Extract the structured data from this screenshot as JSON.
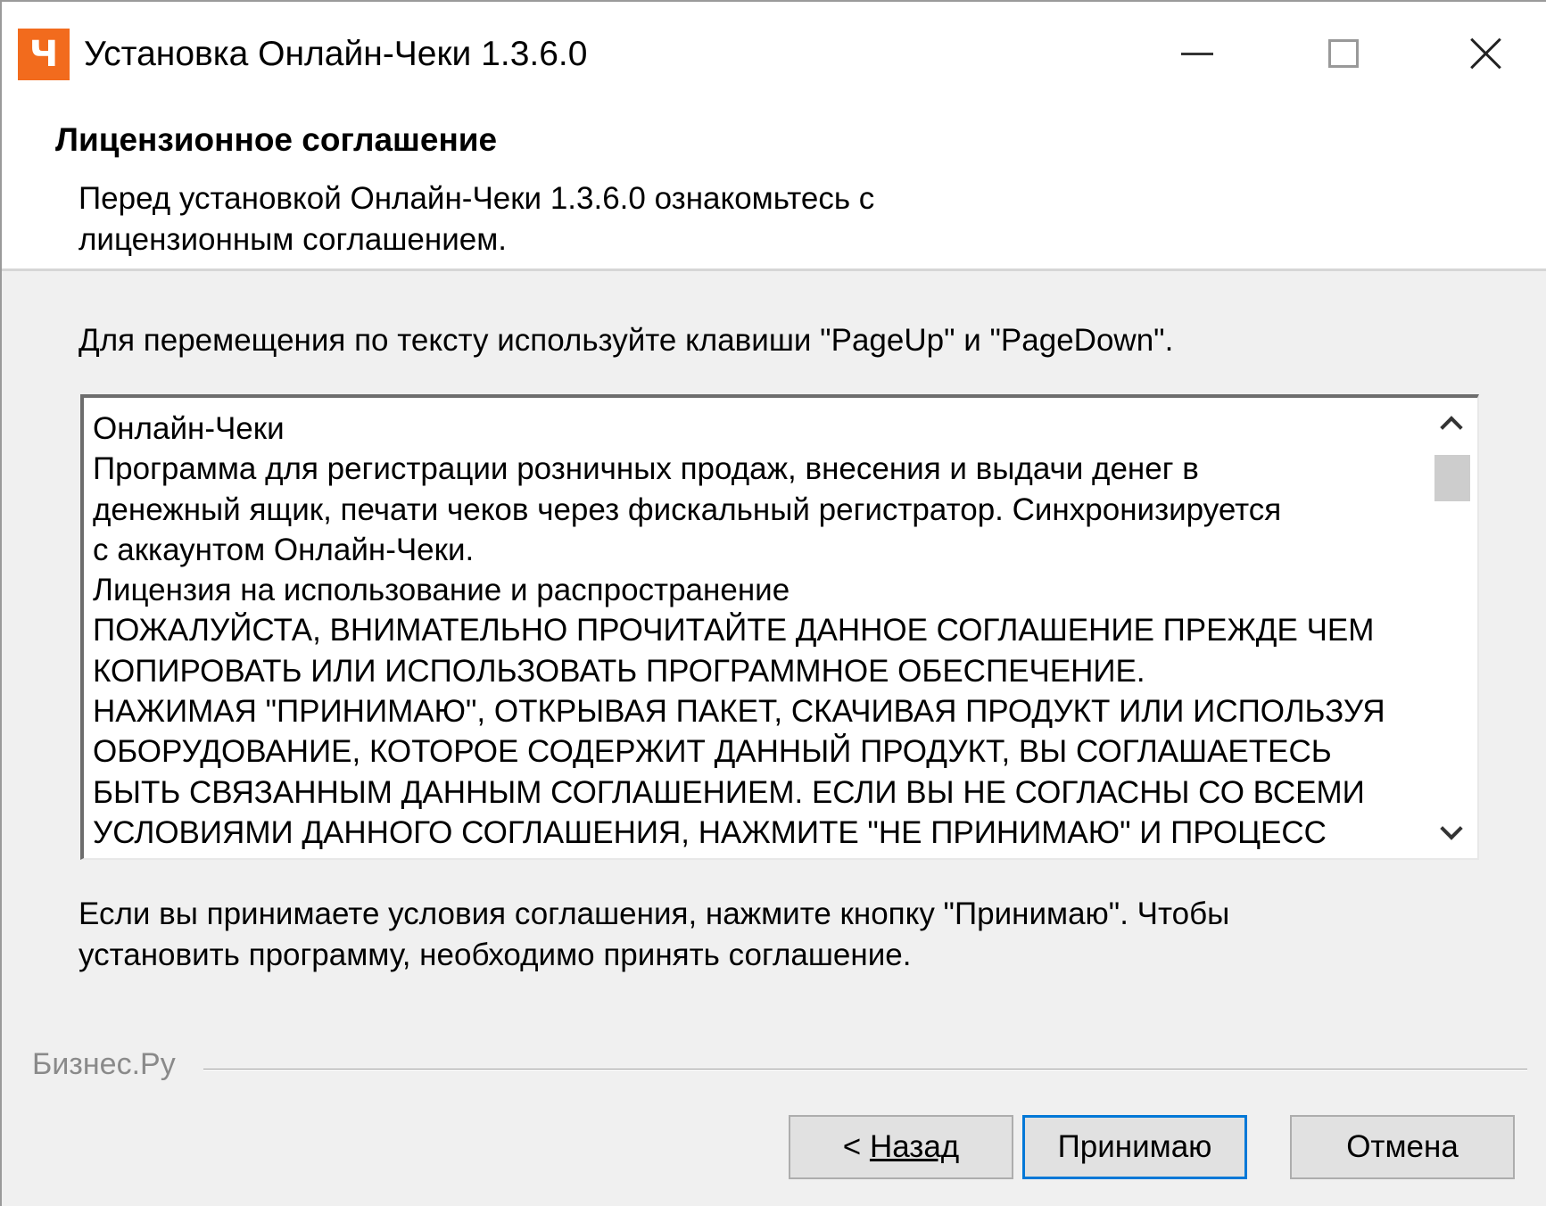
{
  "window": {
    "app_icon_glyph": "Ч",
    "title": "Установка Онлайн-Чеки 1.3.6.0",
    "accent_color": "#f26b1d"
  },
  "header": {
    "title": "Лицензионное соглашение",
    "subtitle_line1": "Перед установкой Онлайн-Чеки 1.3.6.0 ознакомьтесь с",
    "subtitle_line2": "лицензионным соглашением."
  },
  "nav_hint": "Для перемещения по тексту используйте клавиши \"PageUp\" и \"PageDown\".",
  "license": {
    "lines": [
      "Онлайн-Чеки",
      "Программа для регистрации розничных продаж, внесения и выдачи денег в",
      "денежный ящик, печати чеков через фискальный регистратор. Синхронизируется",
      "с аккаунтом Онлайн-Чеки.",
      "Лицензия на использование и распространение",
      "ПОЖАЛУЙСТА, ВНИМАТЕЛЬНО ПРОЧИТАЙТЕ ДАННОЕ СОГЛАШЕНИЕ ПРЕЖДЕ ЧЕМ",
      "КОПИРОВАТЬ ИЛИ ИСПОЛЬЗОВАТЬ ПРОГРАММНОЕ ОБЕСПЕЧЕНИЕ.",
      "НАЖИМАЯ \"ПРИНИМАЮ\", ОТКРЫВАЯ ПАКЕТ, СКАЧИВАЯ ПРОДУКТ ИЛИ ИСПОЛЬЗУЯ",
      "ОБОРУДОВАНИЕ, КОТОРОЕ СОДЕРЖИТ ДАННЫЙ ПРОДУКТ, ВЫ СОГЛАШАЕТЕСЬ",
      "БЫТЬ СВЯЗАННЫМ ДАННЫМ СОГЛАШЕНИЕМ. ЕСЛИ ВЫ НЕ СОГЛАСНЫ СО ВСЕМИ",
      "УСЛОВИЯМИ ДАННОГО СОГЛАШЕНИЯ, НАЖМИТЕ \"НЕ ПРИНИМАЮ\" И ПРОЦЕСС"
    ]
  },
  "accept_hint": {
    "line1": "Если вы принимаете условия соглашения, нажмите кнопку \"Принимаю\". Чтобы",
    "line2": "установить программу, необходимо принять соглашение."
  },
  "footer": {
    "brand": "Бизнес.Ру"
  },
  "buttons": {
    "back_prefix": "< ",
    "back_label": "Назад",
    "accept_label": "Принимаю",
    "cancel_label": "Отмена"
  }
}
